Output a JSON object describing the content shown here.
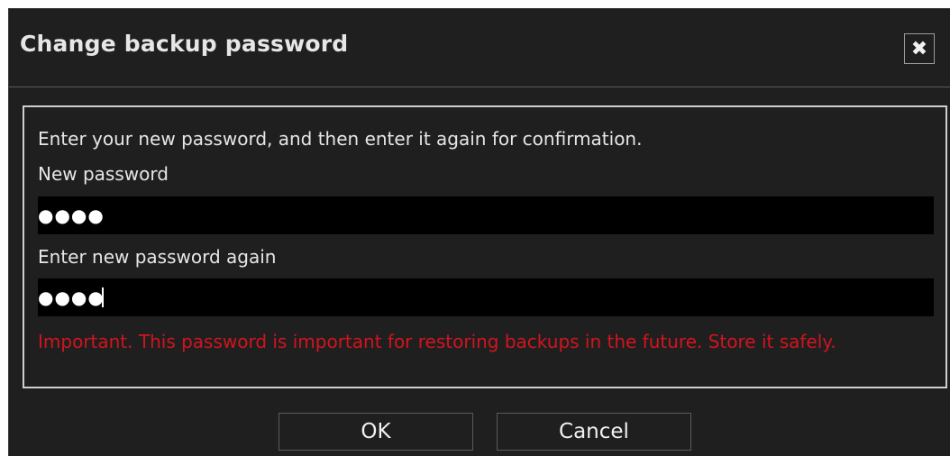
{
  "dialog": {
    "title": "Change backup password",
    "close_symbol": "✖",
    "instructions": "Enter your new password, and then enter it again for confirmation.",
    "new_password_label": "New password",
    "new_password_value": "●●●●",
    "confirm_password_label": "Enter new password again",
    "confirm_password_value": "●●●●",
    "warning": "Important. This password is important for restoring backups in the future. Store it safely.",
    "ok_label": "OK",
    "cancel_label": "Cancel"
  },
  "colors": {
    "background": "#1f1f1f",
    "field": "#000000",
    "text": "#e6e6e6",
    "warning": "#d2141e"
  },
  "icons": {
    "close": "close-icon"
  }
}
